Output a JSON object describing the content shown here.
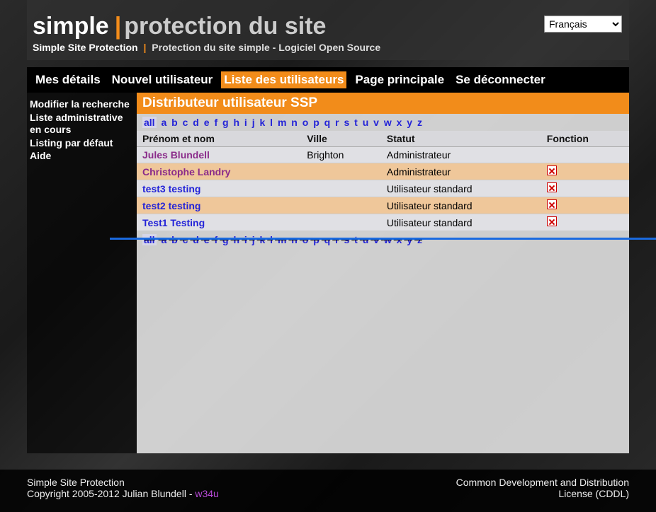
{
  "header": {
    "title_simple": "simple",
    "title_rest": "protection du site",
    "subtitle_left": "Simple Site Protection",
    "subtitle_right": "Protection du site simple - Logiciel Open Source"
  },
  "language": {
    "selected": "Français"
  },
  "nav": {
    "items": [
      "Mes détails",
      "Nouvel utilisateur",
      "Liste des utilisateurs",
      "Page principale",
      "Se déconnecter"
    ],
    "active_index": 2
  },
  "sidebar": {
    "items": [
      "Modifier la recherche",
      "Liste administrative en cours",
      "Listing par défaut",
      "Aide"
    ]
  },
  "panel": {
    "title": "Distributeur utilisateur SSP",
    "alpha": [
      "all",
      "a",
      "b",
      "c",
      "d",
      "e",
      "f",
      "g",
      "h",
      "i",
      "j",
      "k",
      "l",
      "m",
      "n",
      "o",
      "p",
      "q",
      "r",
      "s",
      "t",
      "u",
      "v",
      "w",
      "x",
      "y",
      "z"
    ],
    "columns": {
      "name": "Prénom et nom",
      "city": "Ville",
      "status": "Statut",
      "action": "Fonction"
    },
    "rows": [
      {
        "name": "Jules Blundell",
        "city": "Brighton",
        "status": "Administrateur",
        "deletable": false,
        "visited": true
      },
      {
        "name": "Christophe Landry",
        "city": "",
        "status": "Administrateur",
        "deletable": true,
        "visited": true
      },
      {
        "name": "test3 testing",
        "city": "",
        "status": "Utilisateur standard",
        "deletable": true,
        "visited": false
      },
      {
        "name": "test2 testing",
        "city": "",
        "status": "Utilisateur standard",
        "deletable": true,
        "visited": false
      },
      {
        "name": "Test1 Testing",
        "city": "",
        "status": "Utilisateur standard",
        "deletable": true,
        "visited": false
      }
    ]
  },
  "footer": {
    "left_line1": "Simple Site Protection",
    "left_line2": "Copyright 2005-2012 Julian Blundell - ",
    "left_link": "w34u",
    "right": "Common Development and Distribution License (CDDL)"
  }
}
